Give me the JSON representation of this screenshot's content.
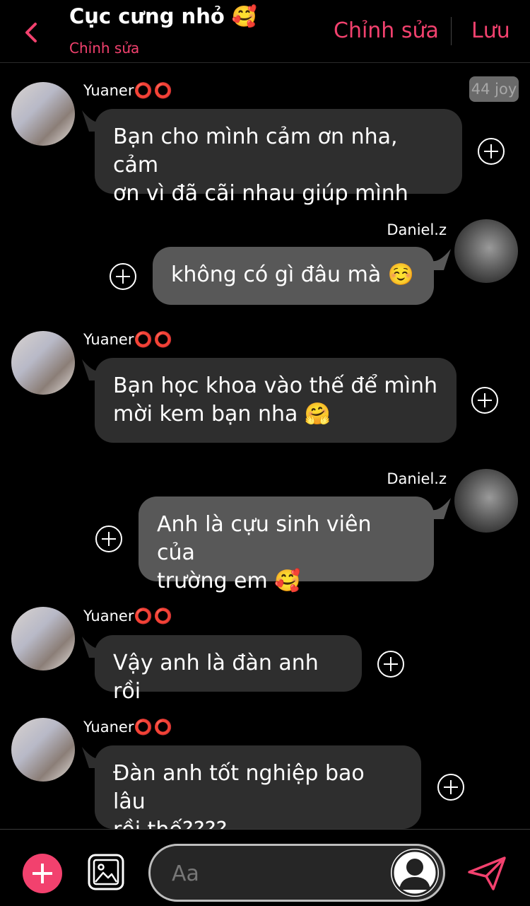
{
  "header": {
    "title": "Cục cưng nhỏ 🥰",
    "subtitle": "Chỉnh sửa",
    "edit_label": "Chỉnh sửa",
    "save_label": "Lưu"
  },
  "joy_badge": "44 joy",
  "messages": [
    {
      "sender": "Yuaner",
      "side": "left",
      "text_lines": [
        "Bạn cho mình cảm ơn nha, cảm",
        "ơn vì đã cãi nhau giúp mình"
      ]
    },
    {
      "sender": "Daniel.z",
      "side": "right",
      "text_lines": [
        "không có gì đâu mà ☺️"
      ]
    },
    {
      "sender": "Yuaner",
      "side": "left",
      "text_lines": [
        "Bạn học khoa vào thế để mình",
        "mời kem bạn nha 🤗"
      ]
    },
    {
      "sender": "Daniel.z",
      "side": "right",
      "text_lines": [
        "Anh là cựu sinh viên của",
        "trường em 🥰"
      ]
    },
    {
      "sender": "Yuaner",
      "side": "left",
      "text_lines": [
        "Vậy anh là đàn anh rồi"
      ]
    },
    {
      "sender": "Yuaner",
      "side": "left",
      "text_lines": [
        "Đàn anh tốt nghiệp bao lâu",
        "rồi thế????"
      ]
    }
  ],
  "sender_suffix": "⭕⭕",
  "input": {
    "placeholder": "Aa"
  },
  "colors": {
    "accent": "#f2416e",
    "bubble_left": "#2e2e2e",
    "bubble_right": "#585858"
  },
  "icons": [
    "back-chevron-icon",
    "plus-circle-icon",
    "image-icon",
    "persona-avatar-icon",
    "send-icon"
  ]
}
